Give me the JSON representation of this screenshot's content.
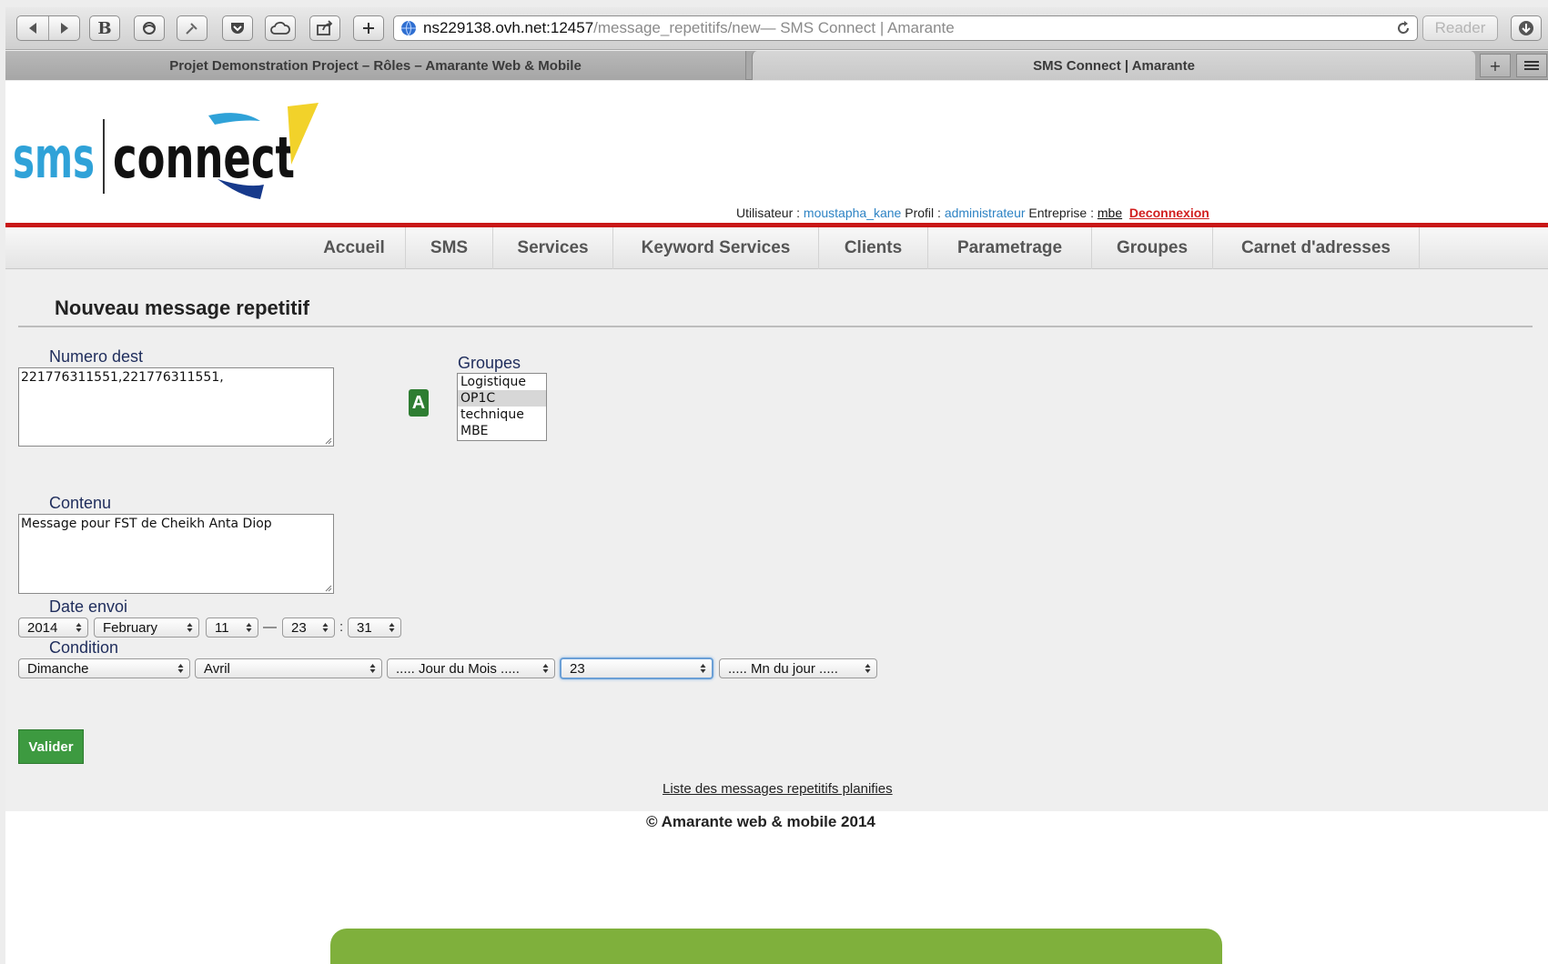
{
  "browser": {
    "url_host": "ns229138.ovh.net:12457",
    "url_path": "/message_repetitifs/new",
    "url_title_suffix": " — SMS Connect | Amarante",
    "reader_label": "Reader",
    "tabs": [
      {
        "label": "Projet Demonstration Project – Rôles – Amarante Web & Mobile"
      },
      {
        "label": "SMS Connect | Amarante"
      }
    ],
    "new_tab_label": "+"
  },
  "header": {
    "logo_text_left": "sms",
    "logo_text_right": "connect",
    "user_label": "Utilisateur : ",
    "user_value": "moustapha_kane",
    "profile_label": " Profil : ",
    "profile_value": "administrateur",
    "company_label": " Entreprise : ",
    "company_value": "mbe",
    "logout_label": "Deconnexion"
  },
  "nav": {
    "items": [
      {
        "label": "Accueil"
      },
      {
        "label": "SMS"
      },
      {
        "label": "Services"
      },
      {
        "label": "Keyword Services"
      },
      {
        "label": "Clients"
      },
      {
        "label": "Parametrage"
      },
      {
        "label": "Groupes"
      },
      {
        "label": "Carnet d'adresses"
      }
    ]
  },
  "form": {
    "title": "Nouveau message repetitif",
    "numero_label": "Numero dest",
    "numero_value": "221776311551,221776311551,",
    "badge_letter": "A",
    "groupes_label": "Groupes",
    "groupes_options": [
      "Logistique",
      "OP1C",
      "technique",
      "MBE"
    ],
    "groupes_selected": "OP1C",
    "contenu_label": "Contenu",
    "contenu_value": "Message pour FST de Cheikh Anta Diop",
    "date_label": "Date envoi",
    "date": {
      "year": "2014",
      "month": "February",
      "day": "11",
      "dash": "—",
      "hour": "23",
      "colon": ":",
      "minute": "31"
    },
    "condition_label": "Condition",
    "condition": {
      "weekday": "Dimanche",
      "month": "Avril",
      "day_of_month": "..... Jour du Mois .....",
      "value": "23",
      "minute_of_day": "..... Mn du jour ....."
    },
    "submit_label": "Valider",
    "list_link": "Liste des messages repetitifs planifies"
  },
  "footer": {
    "copyright": "© Amarante web & mobile 2014"
  },
  "colors": {
    "accent_red": "#c91818",
    "link_blue": "#2d83c4",
    "button_green": "#3d9a40",
    "panel_green": "#7fb03c"
  }
}
